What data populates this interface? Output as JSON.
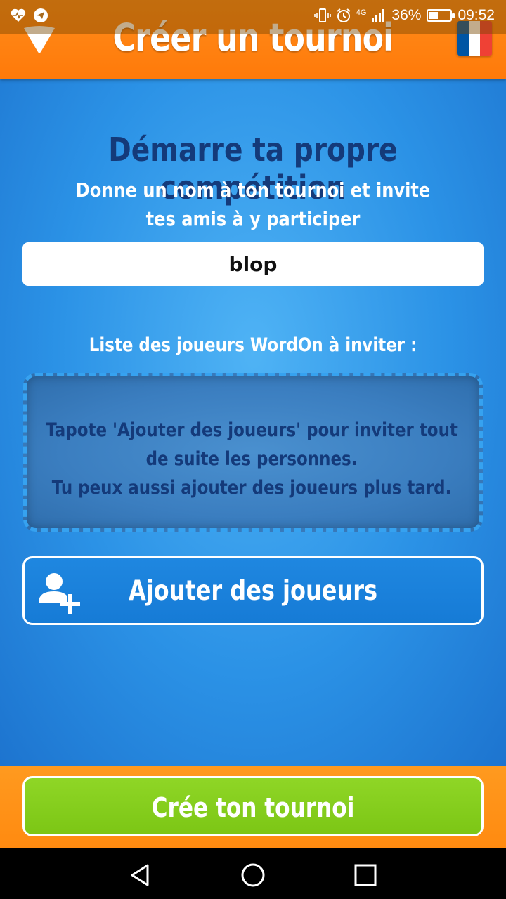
{
  "status_bar": {
    "network": "4G",
    "battery": "36%",
    "time": "09:52",
    "icons": [
      "heart-pulse-icon",
      "telegram-icon",
      "vibrate-icon",
      "alarm-icon",
      "signal-icon",
      "battery-icon"
    ]
  },
  "header": {
    "title": "Créer un tournoi",
    "back_icon": "back-triangle-icon",
    "flag": "france-flag-icon",
    "flag_colors": [
      "#0055a4",
      "#ffffff",
      "#ef4135"
    ]
  },
  "main": {
    "title": "Démarre ta propre compétition",
    "subtitle": "Donne un nom à ton tournoi et invite tes amis à y participer",
    "tournament_name": "blop",
    "list_label": "Liste des joueurs WordOn à inviter :",
    "invite_hint_line1": "Tapote 'Ajouter des joueurs' pour inviter tout de suite les personnes.",
    "invite_hint_line2": "Tu peux aussi ajouter des joueurs plus tard.",
    "add_players_label": "Ajouter des joueurs",
    "add_players_icon": "add-user-icon"
  },
  "footer": {
    "create_label": "Crée ton tournoi"
  },
  "colors": {
    "header": "#ff8a10",
    "title_text": "#143a7a",
    "main_bg": "#2b92e6",
    "create_button": "#7cc615"
  }
}
